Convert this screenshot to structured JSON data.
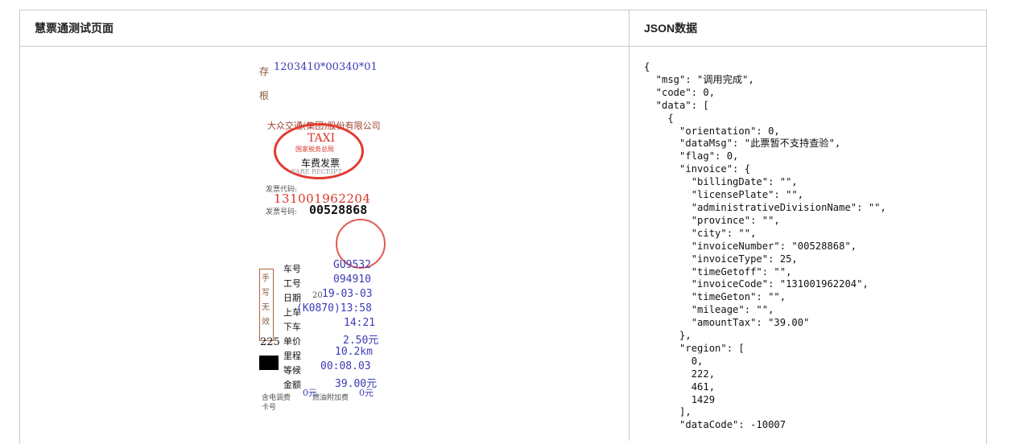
{
  "table": {
    "left_header": "慧票通测试页面",
    "right_header": "JSON数据"
  },
  "receipt": {
    "top_code": "1203410*00340*01",
    "side_char_1": "存",
    "side_char_2": "根",
    "company": "大众交通(集团)股份有限公司",
    "taxi_label": "TAXI",
    "tax_bureau": "国家税务总局",
    "fare_title": "车费发票",
    "fare_receipt": "FARE RECEIPT",
    "code_label": "发票代码:",
    "code_value": "131001962204",
    "number_label": "发票号码:",
    "number_value": "00528868",
    "row_car_label": "车号",
    "row_car_value": "GU9532",
    "row_work_label": "工号",
    "row_work_value": "094910",
    "row_date_label": "日期",
    "row_date_value": "19-03-03",
    "row_date_prefix": "20",
    "row_on_label": "上车",
    "row_on_value": "(K0870)13:58",
    "row_off_label": "下车",
    "row_off_value": "14:21",
    "row_price_label": "单价",
    "row_price_value": "2.50元",
    "row_mile_label": "里程",
    "row_mile_value": "10.2km",
    "row_wait_label": "等候",
    "row_wait_value": "00:08.03",
    "row_amount_label": "金额",
    "row_amount_value": "39.00元",
    "extra_value": "0元",
    "extra_value2": "0元",
    "handwrite_chars": "手写无效",
    "left_num": "225",
    "bottom_text": "含电调费",
    "bottom_text2": "卡号",
    "fuel_text": "燃油附加费"
  },
  "json_text": "{\n  \"msg\": \"调用完成\",\n  \"code\": 0,\n  \"data\": [\n    {\n      \"orientation\": 0,\n      \"dataMsg\": \"此票暂不支持查验\",\n      \"flag\": 0,\n      \"invoice\": {\n        \"billingDate\": \"\",\n        \"licensePlate\": \"\",\n        \"administrativeDivisionName\": \"\",\n        \"province\": \"\",\n        \"city\": \"\",\n        \"invoiceNumber\": \"00528868\",\n        \"invoiceType\": 25,\n        \"timeGetoff\": \"\",\n        \"invoiceCode\": \"131001962204\",\n        \"timeGeton\": \"\",\n        \"mileage\": \"\",\n        \"amountTax\": \"39.00\"\n      },\n      \"region\": [\n        0,\n        222,\n        461,\n        1429\n      ],\n      \"dataCode\": -10007"
}
